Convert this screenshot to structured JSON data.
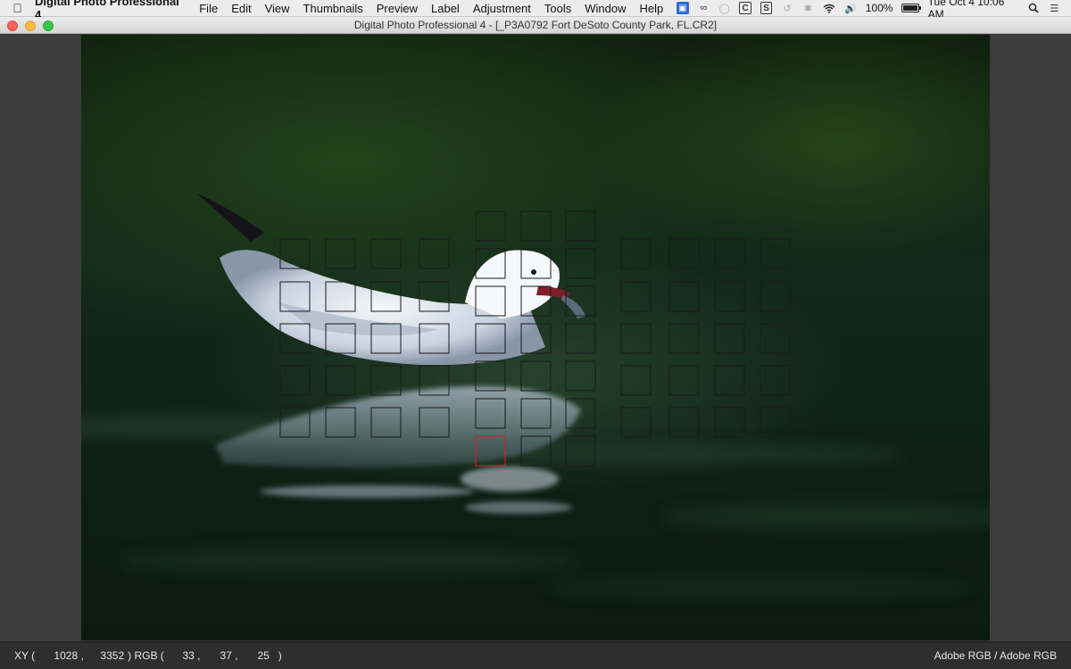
{
  "menubar": {
    "app_name": "Digital Photo Professional 4",
    "items": [
      "File",
      "Edit",
      "View",
      "Thumbnails",
      "Preview",
      "Label",
      "Adjustment",
      "Tools",
      "Window",
      "Help"
    ],
    "battery": "100%",
    "battery_level": 1.0,
    "datetime": "Tue Oct 4  10:06 AM"
  },
  "window": {
    "title": "Digital Photo Professional 4 - [_P3A0792  Fort DeSoto County Park, FL.CR2]"
  },
  "statusbar": {
    "xy_label": "XY (",
    "x": "1028",
    "y": "3352",
    "rgb_label": ") RGB (",
    "r": "33",
    "g": "37",
    "b": "25",
    "close_paren": ")",
    "color_profile": "Adobe RGB / Adobe RGB"
  },
  "colors": {
    "af_point": "#1a1a1a",
    "af_point_active": "#d42020"
  }
}
